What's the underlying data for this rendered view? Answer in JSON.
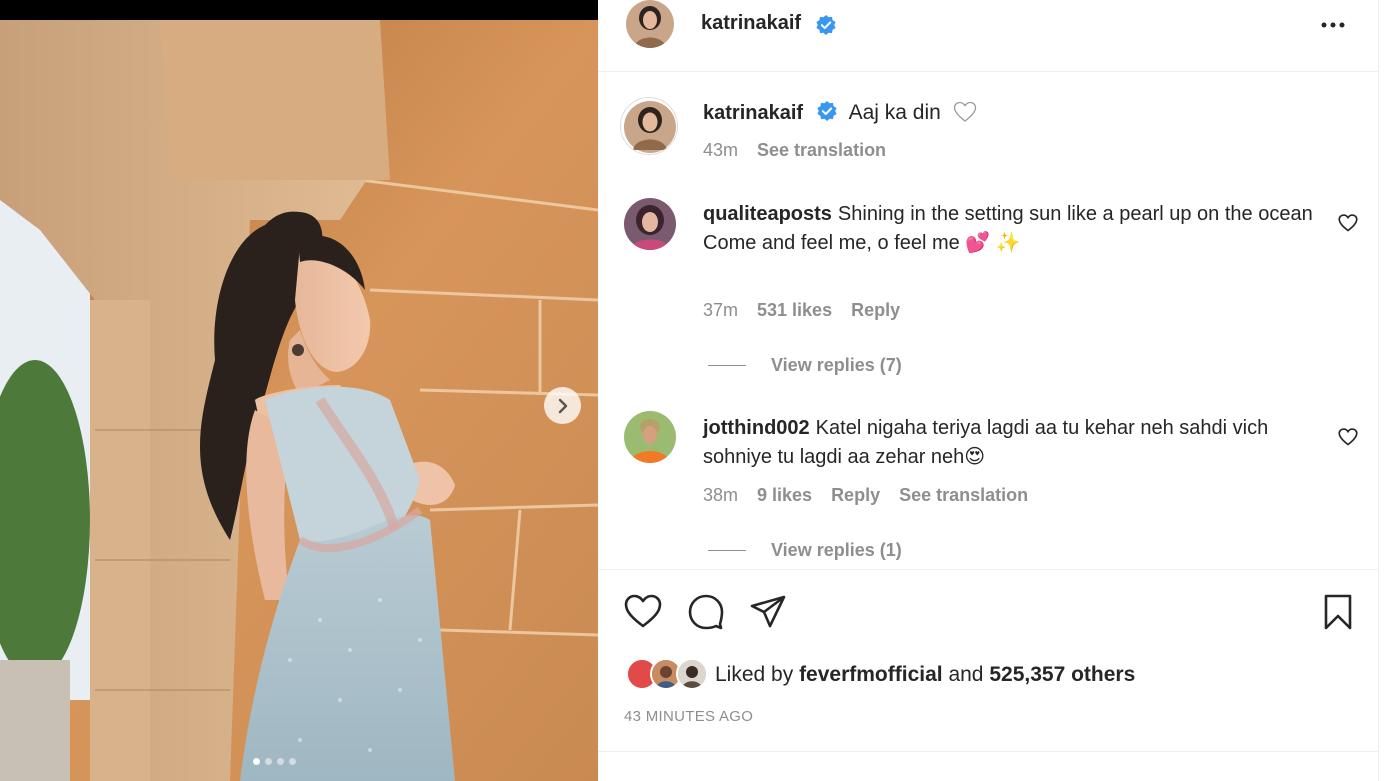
{
  "post": {
    "username": "katrinakaif",
    "caption": "Aaj ka din",
    "caption_time": "43m",
    "see_translation": "See translation",
    "more_menu": "more-options-icon"
  },
  "comments": [
    {
      "username": "qualiteaposts",
      "text_line1": "Shining in the setting sun like a pearl up on the ocean",
      "text_line2": "Come and feel me, o feel me 💕 ✨",
      "time": "37m",
      "likes": "531 likes",
      "reply": "Reply",
      "view_replies": "View replies (7)"
    },
    {
      "username": "jotthind002",
      "text": "Katel nigaha teriya lagdi aa tu kehar neh sahdi vich sohniye tu lagdi aa zehar neh😍",
      "time": "38m",
      "likes": "9 likes",
      "reply": "Reply",
      "see_translation": "See translation",
      "view_replies": "View replies (1)"
    }
  ],
  "likes": {
    "prefix": "Liked by",
    "user": "feverfmofficial",
    "and": "and",
    "count": "525,357 others"
  },
  "timestamp": "43 MINUTES AGO",
  "carousel": {
    "total_slides": 4,
    "active_slide": 1
  },
  "colors": {
    "verified_blue": "#3897f0",
    "text": "#262626",
    "muted": "#8e8e8e"
  }
}
